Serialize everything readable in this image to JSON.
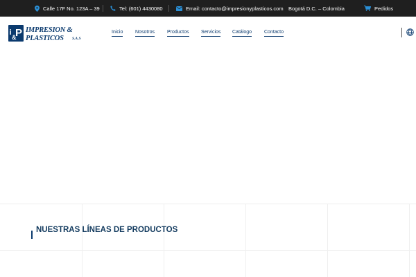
{
  "topbar": {
    "address": "Calle 17F No. 123A – 39",
    "phone": "Tel: (601) 4430080",
    "email": "Email: contacto@impresionyplasticos.com",
    "city": "Bogotá D.C. – Colombia",
    "orders": "Pedidos"
  },
  "logo": {
    "monogram": "i&P",
    "line1": "IMPRESION &",
    "line2": "PLASTICOS",
    "suffix": "S.A.S"
  },
  "nav": {
    "items": [
      {
        "label": "Inicio"
      },
      {
        "label": "Nosotros"
      },
      {
        "label": "Productos"
      },
      {
        "label": "Servicios"
      },
      {
        "label": "Catálogo"
      },
      {
        "label": "Contacto"
      }
    ]
  },
  "section": {
    "title": "NUESTRAS LÍNEAS DE PRODUCTOS"
  },
  "icons": {
    "address": "map-pin-icon",
    "phone": "phone-icon",
    "email": "envelope-icon",
    "orders": "cart-icon",
    "language": "globe-icon"
  },
  "colors": {
    "topbar_bg": "#1f1f1f",
    "accent": "#2a8fd6",
    "brand": "#0b3a6e"
  }
}
